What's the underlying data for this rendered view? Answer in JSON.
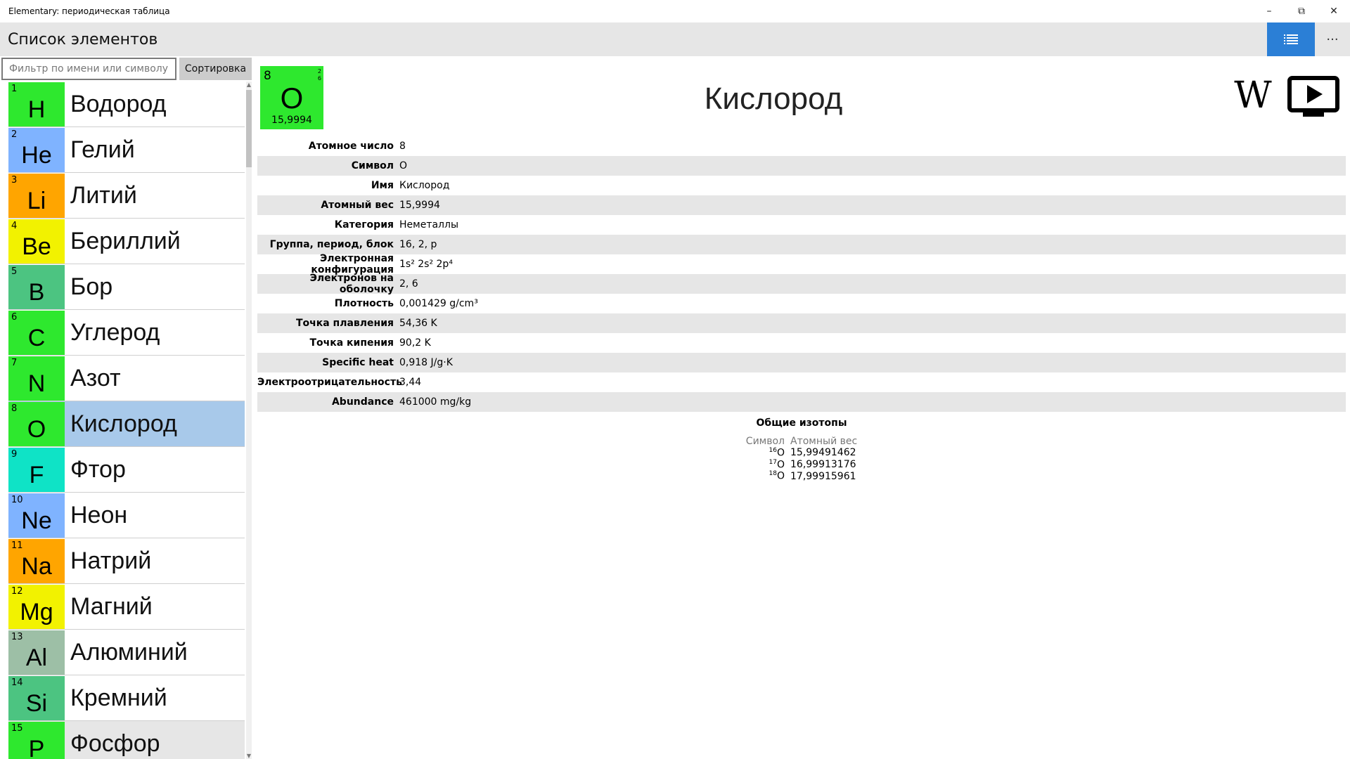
{
  "window": {
    "title": "Elementary: периодическая таблица",
    "minimize": "–",
    "restore": "⧉",
    "close": "✕"
  },
  "appbar": {
    "title": "Список элементов",
    "more": "···"
  },
  "filter": {
    "placeholder": "Фильтр по имени или символу",
    "value": "",
    "sort_label": "Сортировка"
  },
  "elements": [
    {
      "num": "1",
      "sym": "H",
      "name": "Водород",
      "color": "#2ee82e"
    },
    {
      "num": "2",
      "sym": "He",
      "name": "Гелий",
      "color": "#7fb3ff"
    },
    {
      "num": "3",
      "sym": "Li",
      "name": "Литий",
      "color": "#ffa500"
    },
    {
      "num": "4",
      "sym": "Be",
      "name": "Бериллий",
      "color": "#f2f200"
    },
    {
      "num": "5",
      "sym": "B",
      "name": "Бор",
      "color": "#4cc481"
    },
    {
      "num": "6",
      "sym": "C",
      "name": "Углерод",
      "color": "#2ee82e"
    },
    {
      "num": "7",
      "sym": "N",
      "name": "Азот",
      "color": "#2ee82e"
    },
    {
      "num": "8",
      "sym": "O",
      "name": "Кислород",
      "color": "#2ee82e"
    },
    {
      "num": "9",
      "sym": "F",
      "name": "Фтор",
      "color": "#0fe3c6"
    },
    {
      "num": "10",
      "sym": "Ne",
      "name": "Неон",
      "color": "#7fb3ff"
    },
    {
      "num": "11",
      "sym": "Na",
      "name": "Натрий",
      "color": "#ffa500"
    },
    {
      "num": "12",
      "sym": "Mg",
      "name": "Магний",
      "color": "#f2f200"
    },
    {
      "num": "13",
      "sym": "Al",
      "name": "Алюминий",
      "color": "#9dbfa6"
    },
    {
      "num": "14",
      "sym": "Si",
      "name": "Кремний",
      "color": "#4cc481"
    },
    {
      "num": "15",
      "sym": "P",
      "name": "Фосфор",
      "color": "#2ee82e"
    }
  ],
  "selected_index": 7,
  "detail": {
    "number": "8",
    "symbol": "O",
    "mass": "15,9994",
    "shells": [
      "2",
      "6"
    ],
    "name": "Кислород",
    "color": "#2ee82e",
    "wiki_label": "W",
    "properties": [
      {
        "key": "Атомное число",
        "value": "8"
      },
      {
        "key": "Символ",
        "value": "O"
      },
      {
        "key": "Имя",
        "value": "Кислород"
      },
      {
        "key": "Атомный вес",
        "value": "15,9994"
      },
      {
        "key": "Категория",
        "value": "Неметаллы"
      },
      {
        "key": "Группа, период, блок",
        "value": "16, 2, p"
      },
      {
        "key": "Электронная конфигурация",
        "value": "1s² 2s² 2p⁴"
      },
      {
        "key": "Электронов на оболочку",
        "value": "2, 6"
      },
      {
        "key": "Плотность",
        "value": "0,001429 g/cm³"
      },
      {
        "key": "Точка плавления",
        "value": "54,36 K"
      },
      {
        "key": "Точка кипения",
        "value": "90,2 K"
      },
      {
        "key": "Specific heat",
        "value": "0,918 J/g·K"
      },
      {
        "key": "Электроотрицательность",
        "value": "3,44"
      },
      {
        "key": "Abundance",
        "value": "461000 mg/kg"
      }
    ],
    "isotopes": {
      "title": "Общие изотопы",
      "col_symbol": "Символ",
      "col_mass": "Атомный вес",
      "rows": [
        {
          "mass_number": "16",
          "sym": "O",
          "weight": "15,99491462"
        },
        {
          "mass_number": "17",
          "sym": "O",
          "weight": "16,99913176"
        },
        {
          "mass_number": "18",
          "sym": "O",
          "weight": "17,99915961"
        }
      ]
    }
  }
}
